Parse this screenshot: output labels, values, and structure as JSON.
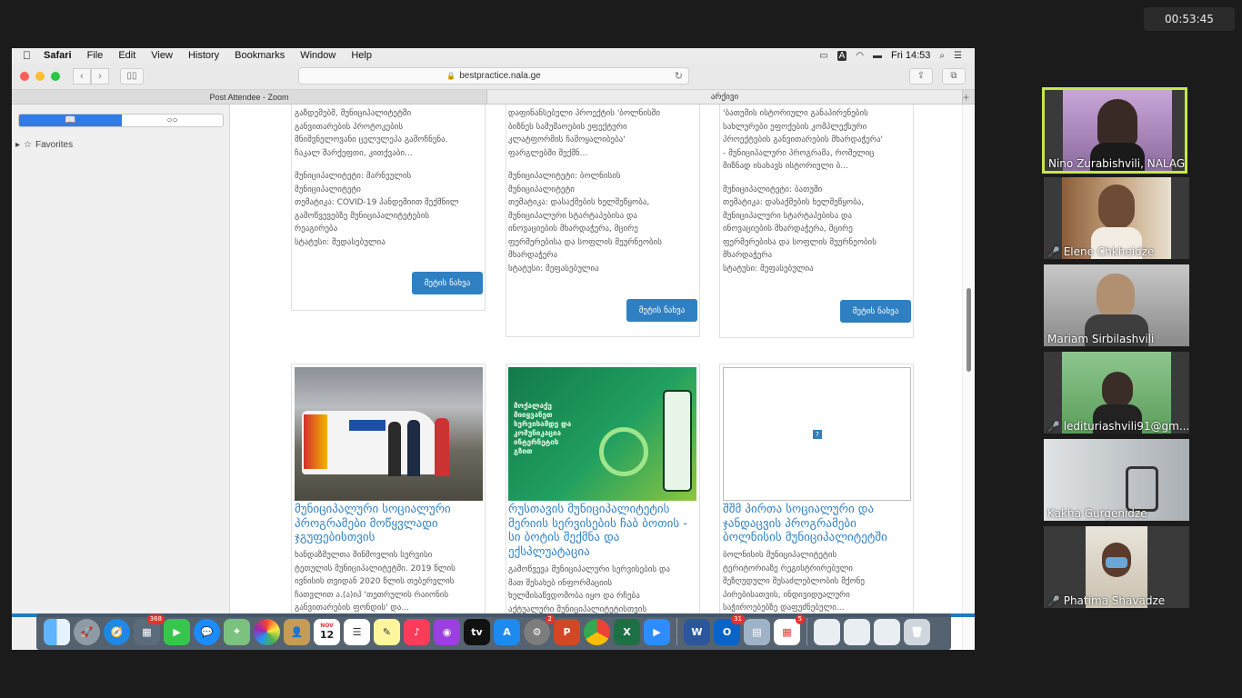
{
  "zoom": {
    "timer": "00:53:45",
    "participants": [
      {
        "name": "Nino Zurabishvili, NALAG",
        "muted": false,
        "active": true
      },
      {
        "name": "Elene Chkheidze",
        "muted": true,
        "active": false
      },
      {
        "name": "Mariam Sirbilashvili",
        "muted": false,
        "active": false
      },
      {
        "name": "ledituriashvili91@gm...",
        "muted": true,
        "active": false
      },
      {
        "name": "Kakha Gurgenidze",
        "muted": false,
        "active": false
      },
      {
        "name": "Phatima Shavadze",
        "muted": true,
        "active": false
      }
    ]
  },
  "menubar": {
    "app": "Safari",
    "items": [
      "File",
      "Edit",
      "View",
      "History",
      "Bookmarks",
      "Window",
      "Help"
    ],
    "clock": "Fri 14:53"
  },
  "browser": {
    "url": "bestpractice.nala.ge",
    "tabs": [
      "Post Attendee - Zoom",
      "არქივი"
    ],
    "sidebar": {
      "favorites": "Favorites"
    }
  },
  "cards_top": [
    {
      "lines": [
        "გაზდემებმ,    მუნიციპალიტეტში",
        "განვითარების         პროტოკების",
        "მნიშვნელოვანი ცელულეპა გამოჩნენა.",
        "ჩაკალ მარქეფთი, კითქვაბი..."
      ],
      "meta": [
        "მუნიციპალიტეტი:          მარნეულის",
        "მუნიციპალიტეტი",
        "თემატიკა: COVID-19 პანდემიით შექმნილ",
        "გამოწვევებზე    მუნიციპალიტეტების",
        "რეაგირება",
        "სტატუსი: მუდასებულია"
      ],
      "button": "მეტის ნახვა"
    },
    {
      "lines": [
        "დაფინანსებული პროექტის 'ბოლნისში",
        "ბიზნეს  სამუშაოების  ეფექტური",
        "კლატფორმის            ჩამოყალიბება'",
        "ფარგლებში შექმნ..."
      ],
      "meta": [
        "მუნიციპალიტეტი:            ბოლნისის",
        "მუნიციპალიტეტი",
        "თემატიკა:    დასაქმების    ხელშეწყობა,",
        "მუნიციპალური   სტარტაპებისა   და",
        "ინოვაციების  მხარდაჭერა,  მცირე",
        "ფერმერებისა და სოფლის მეურნეობის",
        "მხარდაჭერა",
        "სტატუსი: მეფასებულია"
      ],
      "button": "მეტის ნახვა"
    },
    {
      "lines": [
        "'ბათუმის  ისტორიული  განაპირენების",
        "სახლურები  ეფოქების  კომპლექსური",
        "პროექტების განვითარების მხარდაჭერა'",
        "- მუნიციპალური პროგრამა, რომელიც",
        "მიზნად ისახავს ისტორიული ბ..."
      ],
      "meta": [
        "მუნიციპალიტეტი: ბათუმი",
        "თემატიკა:  დასაქმების  ხელშეწყობა,",
        "მუნიციპალური  სტარტაპებისა  და",
        "ინოვაციების  მხარდაჭერა,  მცირე",
        "ფერმერებისა და სოფლის მეურნეობის",
        "მხარდაჭერა",
        "სტატუსი: მეფასებულია"
      ],
      "button": "მეტის ნახვა"
    }
  ],
  "cards_bottom": [
    {
      "title": "მუნიციპალური სოციალური პროგრამები მოწყვლადი ჯგუფებისთვის",
      "lines": [
        "ხანდაზმულთა   შინმოვლის   სერვისი",
        "ტეთულის მუნიციპალიტეტში. 2019 წლის",
        "ივნისის თვიდან 2020 წლის თებერვლის",
        "ჩათვლით ა.(ა)იპ 'თეთრულის რაიონის",
        "განვითარების ფონდის' და..."
      ]
    },
    {
      "title": "რუსთავის მუნიციპალიტეტის მერიის სერვისების ჩაბ ბოთის - სი ბოტის შექმნა და ექსპლუატაცია",
      "poster": "მოქალაქე მიიყვანეთ სერვისამდე და კომუნიკაცია ინტერნეტის გზით",
      "lines": [
        "გამოწვევა მუნიციპალური სერვისების და",
        "მათ   შესახებ   ინფორმაციის",
        "ხელმისაწვდომობა  იყო  და  რჩება",
        "აქტუალური   მუნიციპალიტეტისთვის"
      ]
    },
    {
      "title": "შშმ პირთა სოციალური და ჯანდაცვის პროგრამები ბოლნისის მუნიციპალიტეტში",
      "lines": [
        "ბოლნისის        მუნიციპალიტეტის",
        "ტერიტორიაზე    რეგისტრირებული",
        "შეზღუდული  შესაძლებლობის  მქონე",
        "პირებისათვის,          ინდივიდუალური",
        "საჭიროებებზე         დაფუძნებული..."
      ]
    }
  ],
  "dock": {
    "badges": {
      "photos": "368",
      "calendar_date": "12",
      "calendar_month": "NOV",
      "settings": "2",
      "outlook": "31",
      "office": "5"
    }
  }
}
